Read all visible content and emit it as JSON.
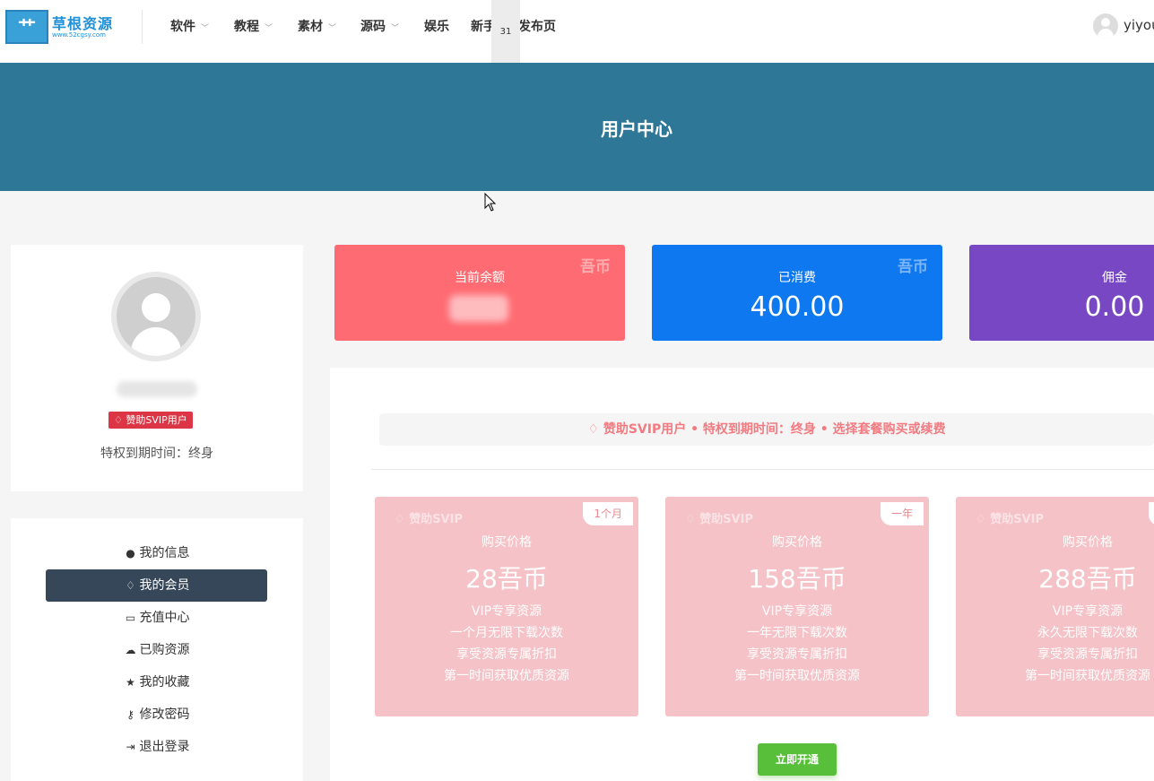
{
  "header": {
    "logo_text": "草根资源",
    "logo_url": "www.52cgsy.com",
    "nav": [
      {
        "label": "软件",
        "has_dropdown": true
      },
      {
        "label": "教程",
        "has_dropdown": true
      },
      {
        "label": "素材",
        "has_dropdown": true
      },
      {
        "label": "源码",
        "has_dropdown": true
      },
      {
        "label": "娱乐",
        "has_dropdown": false
      },
      {
        "label": "新手",
        "has_dropdown": false
      },
      {
        "label": "发布页",
        "has_dropdown": false
      }
    ],
    "floating_badge": "31",
    "user_name": "yiyou"
  },
  "banner": {
    "title": "用户中心"
  },
  "profile": {
    "vip_badge": "赞助SVIP用户",
    "expire_text": "特权到期时间：终身"
  },
  "menu": [
    {
      "label": "我的信息",
      "icon": "user-icon",
      "active": false
    },
    {
      "label": "我的会员",
      "icon": "diamond-icon",
      "active": true
    },
    {
      "label": "充值中心",
      "icon": "credit-card-icon",
      "active": false
    },
    {
      "label": "已购资源",
      "icon": "cloud-download-icon",
      "active": false
    },
    {
      "label": "我的收藏",
      "icon": "star-icon",
      "active": false
    },
    {
      "label": "修改密码",
      "icon": "key-icon",
      "active": false
    },
    {
      "label": "退出登录",
      "icon": "sign-out-icon",
      "active": false
    }
  ],
  "stats": [
    {
      "label": "当前余额",
      "value": "",
      "coin": "吾币",
      "color": "#ff6b72"
    },
    {
      "label": "已消费",
      "value": "400.00",
      "coin": "吾币",
      "color": "#0d78f0"
    },
    {
      "label": "佣金",
      "value": "0.00",
      "coin": "",
      "color": "#7848c4"
    }
  ],
  "notice": "赞助SVIP用户 • 特权到期时间：终身 • 选择套餐购买或续费",
  "plans": [
    {
      "tag": "赞助SVIP",
      "period": "1个月",
      "price_label": "购买价格",
      "price": "28吾币",
      "features": [
        "VIP专享资源",
        "一个月无限下载次数",
        "享受资源专属折扣",
        "第一时间获取优质资源"
      ]
    },
    {
      "tag": "赞助SVIP",
      "period": "一年",
      "price_label": "购买价格",
      "price": "158吾币",
      "features": [
        "VIP专享资源",
        "一年无限下载次数",
        "享受资源专属折扣",
        "第一时间获取优质资源"
      ]
    },
    {
      "tag": "赞助SVIP",
      "period": "",
      "price_label": "购买价格",
      "price": "288吾币",
      "features": [
        "VIP专享资源",
        "永久无限下载次数",
        "享受资源专属折扣",
        "第一时间获取优质资源"
      ]
    }
  ],
  "open_button": "立即开通",
  "colors": {
    "banner": "#2e7796",
    "plan_bg": "#f4c2c7",
    "accent_red": "#dc3545",
    "button_green": "#58bf3a",
    "menu_active": "#354759"
  }
}
